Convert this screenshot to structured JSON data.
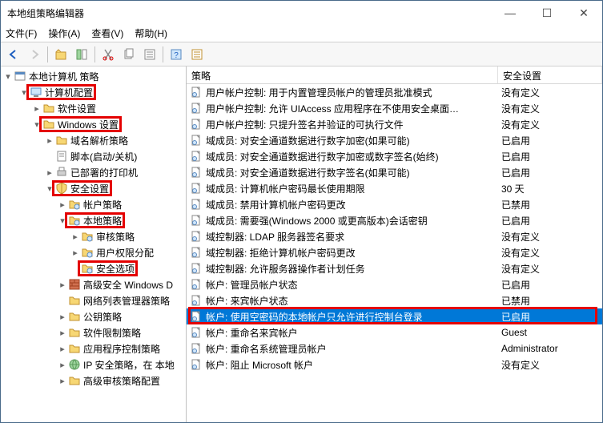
{
  "window": {
    "title": "本地组策略编辑器",
    "controls": {
      "min": "—",
      "max": "☐",
      "close": "✕"
    }
  },
  "menu": {
    "file": "文件(F)",
    "action": "操作(A)",
    "view": "查看(V)",
    "help": "帮助(H)"
  },
  "toolbar": {
    "back": "←",
    "forward": "→",
    "up": "↑",
    "show": "▦",
    "new": "▧",
    "cut": "✂",
    "copy": "⧉",
    "paste": "▣",
    "props": "☰",
    "help2": "?",
    "list": "▤"
  },
  "tree": {
    "root": "本地计算机 策略",
    "nodes": [
      {
        "label": "计算机配置",
        "depth": 1,
        "expand": "▾",
        "icon": "computer",
        "highlight": true
      },
      {
        "label": "软件设置",
        "depth": 2,
        "expand": "▸",
        "icon": "folder"
      },
      {
        "label": "Windows 设置",
        "depth": 2,
        "expand": "▾",
        "icon": "folder",
        "highlight": true
      },
      {
        "label": "域名解析策略",
        "depth": 3,
        "expand": "▸",
        "icon": "folder"
      },
      {
        "label": "脚本(启动/关机)",
        "depth": 3,
        "expand": "",
        "icon": "script"
      },
      {
        "label": "已部署的打印机",
        "depth": 3,
        "expand": "▸",
        "icon": "printer"
      },
      {
        "label": "安全设置",
        "depth": 3,
        "expand": "▾",
        "icon": "security",
        "highlight": true
      },
      {
        "label": "帐户策略",
        "depth": 4,
        "expand": "▸",
        "icon": "folder-sec"
      },
      {
        "label": "本地策略",
        "depth": 4,
        "expand": "▾",
        "icon": "folder-sec",
        "highlight": true
      },
      {
        "label": "审核策略",
        "depth": 5,
        "expand": "▸",
        "icon": "folder-sec"
      },
      {
        "label": "用户权限分配",
        "depth": 5,
        "expand": "▸",
        "icon": "folder-sec"
      },
      {
        "label": "安全选项",
        "depth": 5,
        "expand": "",
        "icon": "folder-sec",
        "highlight": true
      },
      {
        "label": "高级安全 Windows D",
        "depth": 4,
        "expand": "▸",
        "icon": "firewall"
      },
      {
        "label": "网络列表管理器策略",
        "depth": 4,
        "expand": "",
        "icon": "folder"
      },
      {
        "label": "公钥策略",
        "depth": 4,
        "expand": "▸",
        "icon": "folder"
      },
      {
        "label": "软件限制策略",
        "depth": 4,
        "expand": "▸",
        "icon": "folder"
      },
      {
        "label": "应用程序控制策略",
        "depth": 4,
        "expand": "▸",
        "icon": "folder"
      },
      {
        "label": "IP 安全策略，在 本地",
        "depth": 4,
        "expand": "▸",
        "icon": "ipsec"
      },
      {
        "label": "高级审核策略配置",
        "depth": 4,
        "expand": "▸",
        "icon": "folder"
      }
    ]
  },
  "list": {
    "header": {
      "policy": "策略",
      "setting": "安全设置"
    },
    "rows": [
      {
        "policy": "用户帐户控制: 用于内置管理员帐户的管理员批准模式",
        "setting": "没有定义"
      },
      {
        "policy": "用户帐户控制: 允许 UIAccess 应用程序在不使用安全桌面…",
        "setting": "没有定义"
      },
      {
        "policy": "用户帐户控制: 只提升签名并验证的可执行文件",
        "setting": "没有定义"
      },
      {
        "policy": "域成员: 对安全通道数据进行数字加密(如果可能)",
        "setting": "已启用"
      },
      {
        "policy": "域成员: 对安全通道数据进行数字加密或数字签名(始终)",
        "setting": "已启用"
      },
      {
        "policy": "域成员: 对安全通道数据进行数字签名(如果可能)",
        "setting": "已启用"
      },
      {
        "policy": "域成员: 计算机帐户密码最长使用期限",
        "setting": "30 天"
      },
      {
        "policy": "域成员: 禁用计算机帐户密码更改",
        "setting": "已禁用"
      },
      {
        "policy": "域成员: 需要强(Windows 2000 或更高版本)会话密钥",
        "setting": "已启用"
      },
      {
        "policy": "域控制器: LDAP 服务器签名要求",
        "setting": "没有定义"
      },
      {
        "policy": "域控制器: 拒绝计算机帐户密码更改",
        "setting": "没有定义"
      },
      {
        "policy": "域控制器: 允许服务器操作者计划任务",
        "setting": "没有定义"
      },
      {
        "policy": "帐户: 管理员帐户状态",
        "setting": "已启用"
      },
      {
        "policy": "帐户: 来宾帐户状态",
        "setting": "已禁用"
      },
      {
        "policy": "帐户: 使用空密码的本地帐户只允许进行控制台登录",
        "setting": "已启用",
        "selected": true,
        "highlight": true
      },
      {
        "policy": "帐户: 重命名来宾帐户",
        "setting": "Guest"
      },
      {
        "policy": "帐户: 重命名系统管理员帐户",
        "setting": "Administrator"
      },
      {
        "policy": "帐户: 阻止 Microsoft 帐户",
        "setting": "没有定义"
      }
    ]
  }
}
